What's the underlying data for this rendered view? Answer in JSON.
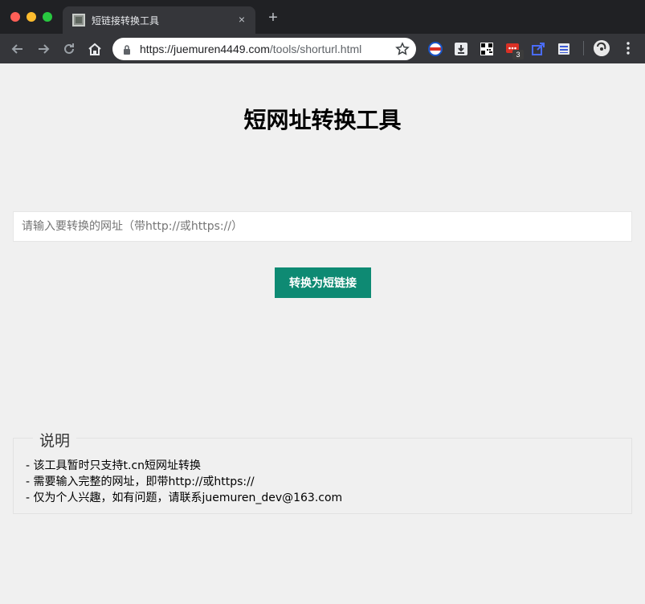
{
  "browser": {
    "tab_title": "短链接转换工具",
    "tab_close": "×",
    "new_tab": "+",
    "url_host": "https://juemuren4449.com",
    "url_path": "/tools/shorturl.html",
    "extension_badge": "3"
  },
  "page": {
    "title": "短网址转换工具",
    "input_placeholder": "请输入要转换的网址（带http://或https://）",
    "input_value": "",
    "convert_button": "转换为短链接",
    "notes_legend": "说明",
    "notes": [
      "- 该工具暂时只支持t.cn短网址转换",
      "- 需要输入完整的网址，即带http://或https://",
      "- 仅为个人兴趣，如有问题，请联系juemuren_dev@163.com"
    ]
  },
  "colors": {
    "accent": "#0e8a73",
    "page_bg": "#f0f0f0",
    "chrome_dark": "#202124",
    "chrome_toolbar": "#35363a"
  }
}
